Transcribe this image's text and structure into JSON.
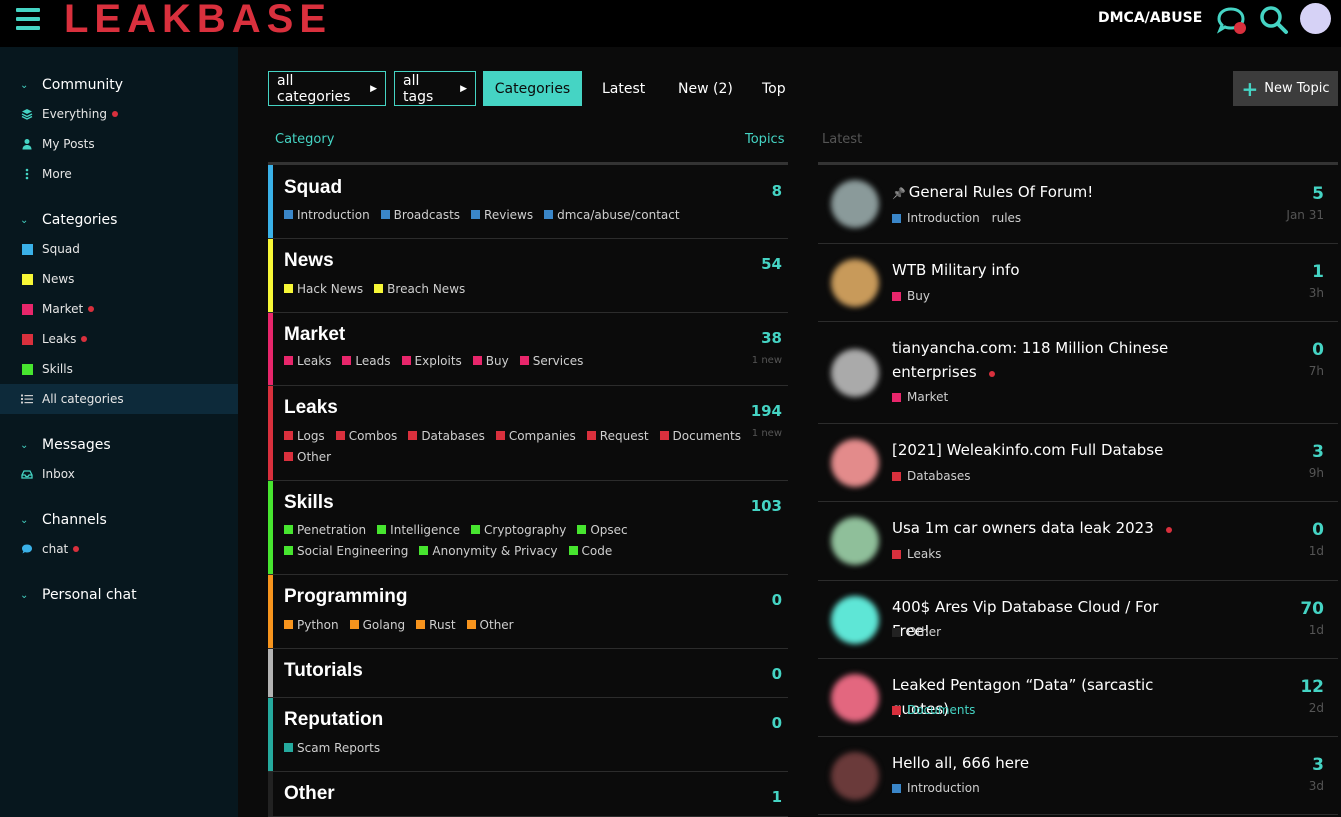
{
  "header": {
    "logo": "LEAKBASE",
    "dmca": "DMCA/ABUSE"
  },
  "sidebar": {
    "sections": [
      {
        "label": "Community"
      },
      {
        "label": "Categories"
      },
      {
        "label": "Messages"
      },
      {
        "label": "Channels"
      },
      {
        "label": "Personal chat"
      }
    ],
    "community_items": [
      {
        "label": "Everything"
      },
      {
        "label": "My Posts"
      },
      {
        "label": "More"
      }
    ],
    "category_items": [
      {
        "label": "Squad",
        "color": "#3ab1e8"
      },
      {
        "label": "News",
        "color": "#f7f736"
      },
      {
        "label": "Market",
        "color": "#e8266b"
      },
      {
        "label": "Leaks",
        "color": "#d9303d"
      },
      {
        "label": "Skills",
        "color": "#47e52f"
      },
      {
        "label": "All categories"
      }
    ],
    "message_items": [
      {
        "label": "Inbox"
      }
    ],
    "channel_items": [
      {
        "label": "chat"
      }
    ]
  },
  "nav": {
    "all_categories": "all categories",
    "all_tags": "all tags",
    "categories": "Categories",
    "latest": "Latest",
    "new": "New (2)",
    "top": "Top",
    "new_topic": "New Topic"
  },
  "table": {
    "category_header": "Category",
    "topics_header": "Topics",
    "latest_header": "Latest"
  },
  "categories": [
    {
      "name": "Squad",
      "count": "8",
      "color": "#3ab1e8",
      "new": "",
      "subs": [
        "Introduction",
        "Broadcasts",
        "Reviews",
        "dmca/abuse/contact"
      ],
      "sub_color": "#3a86c8"
    },
    {
      "name": "News",
      "count": "54",
      "color": "#f7f736",
      "new": "",
      "subs": [
        "Hack News",
        "Breach News"
      ],
      "sub_color": "#f7f736"
    },
    {
      "name": "Market",
      "count": "38",
      "color": "#e8266b",
      "new": "1 new",
      "subs": [
        "Leaks",
        "Leads",
        "Exploits",
        "Buy",
        "Services"
      ],
      "sub_color": "#e8266b"
    },
    {
      "name": "Leaks",
      "count": "194",
      "color": "#d9303d",
      "new": "1 new",
      "subs": [
        "Logs",
        "Combos",
        "Databases",
        "Companies",
        "Request",
        "Documents",
        "Other"
      ],
      "sub_color": "#d9303d"
    },
    {
      "name": "Skills",
      "count": "103",
      "color": "#47e52f",
      "new": "",
      "subs": [
        "Penetration",
        "Intelligence",
        "Cryptography",
        "Opsec",
        "Social Engineering",
        "Anonymity & Privacy",
        "Code"
      ],
      "sub_color": "#47e52f"
    },
    {
      "name": "Programming",
      "count": "0",
      "color": "#f7941d",
      "new": "",
      "subs": [
        "Python",
        "Golang",
        "Rust",
        "Other"
      ],
      "sub_color": "#f7941d"
    },
    {
      "name": "Tutorials",
      "count": "0",
      "color": "#b3b3b3",
      "new": "",
      "subs": [],
      "sub_color": "#b3b3b3"
    },
    {
      "name": "Reputation",
      "count": "0",
      "color": "#25aa9e",
      "new": "",
      "subs": [
        "Scam Reports"
      ],
      "sub_color": "#25aa9e"
    },
    {
      "name": "Other",
      "count": "1",
      "color": "#222222",
      "new": "",
      "subs": [],
      "sub_color": "#222222"
    }
  ],
  "latest": [
    {
      "pin": "📌",
      "title": "General Rules Of Forum!",
      "cat": "Introduction",
      "cat_color": "#3a86c8",
      "tag": "rules",
      "count": "5",
      "age": "Jan 31",
      "thumb": "#8a9a9a",
      "dot": false
    },
    {
      "pin": "",
      "title": "WTB Military info",
      "cat": "Buy",
      "cat_color": "#e8266b",
      "tag": "",
      "count": "1",
      "age": "3h",
      "thumb": "#c89a5a",
      "dot": false
    },
    {
      "pin": "",
      "title": "tianyancha.com: 118 Million Chinese enterprises",
      "cat": "Market",
      "cat_color": "#e8266b",
      "tag": "",
      "count": "0",
      "age": "7h",
      "thumb": "#aaaaaa",
      "dot": true
    },
    {
      "pin": "",
      "title": "[2021] Weleakinfo.com Full Databse",
      "cat": "Databases",
      "cat_color": "#d9303d",
      "tag": "",
      "count": "3",
      "age": "9h",
      "thumb": "#e38b8b",
      "dot": false
    },
    {
      "pin": "",
      "title": "Usa 1m car owners data leak 2023",
      "cat": "Leaks",
      "cat_color": "#d9303d",
      "tag": "",
      "count": "0",
      "age": "1d",
      "thumb": "#8fbf9a",
      "dot": true
    },
    {
      "pin": "",
      "title": "400$ Ares Vip Database Cloud / For Free!",
      "cat": "Other",
      "cat_color": "#222222",
      "tag": "",
      "count": "70",
      "age": "1d",
      "thumb": "#5ee6d6",
      "dot": false
    },
    {
      "pin": "",
      "title": "Leaked Pentagon “Data” (sarcastic quotes)",
      "cat": "Documents",
      "cat_color": "#d9303d",
      "cat_text_color": "#45d4c4",
      "tag": "",
      "count": "12",
      "age": "2d",
      "thumb": "#e3677f",
      "dot": false
    },
    {
      "pin": "",
      "title": "Hello all, 666 here",
      "cat": "Introduction",
      "cat_color": "#3a86c8",
      "tag": "",
      "count": "3",
      "age": "3d",
      "thumb": "#6a3a3a",
      "dot": false
    }
  ]
}
